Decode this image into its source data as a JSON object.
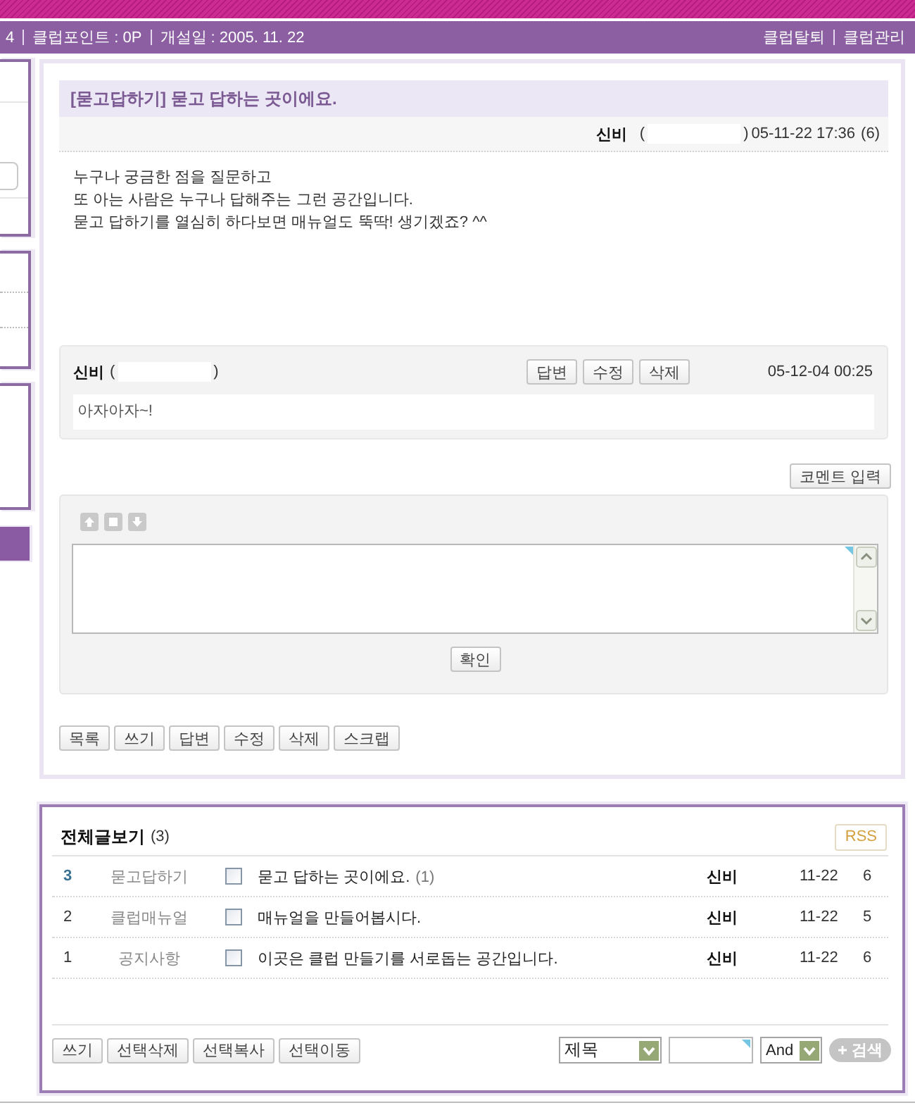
{
  "header": {
    "info": [
      "4",
      "클럽포인트 : 0P",
      "개설일 : 2005. 11. 22"
    ],
    "links": [
      "클럽탈퇴",
      "클럽관리"
    ]
  },
  "post": {
    "title": "[묻고답하기] 묻고 답하는 곳이에요.",
    "author": "신비",
    "id_brackets": [
      "(",
      ")"
    ],
    "datetime": "05-11-22 17:36",
    "views": "(6)",
    "body": [
      "누구나 궁금한 점을 질문하고",
      "또 아는 사람은 누구나 답해주는 그런 공간입니다.",
      "묻고 답하기를 열심히 하다보면 매뉴얼도 뚝딱! 생기겠죠? ^^"
    ]
  },
  "comments": [
    {
      "author": "신비",
      "id_brackets": [
        "(",
        ")"
      ],
      "buttons": [
        "답변",
        "수정",
        "삭제"
      ],
      "datetime": "05-12-04 00:25",
      "text": "아자아자~!"
    }
  ],
  "comment_form": {
    "open_button": "코멘트 입력",
    "submit_button": "확인"
  },
  "post_buttons": [
    "목록",
    "쓰기",
    "답변",
    "수정",
    "삭제",
    "스크랩"
  ],
  "board": {
    "title": "전체글보기",
    "count": "(3)",
    "rss": "RSS",
    "rows": [
      {
        "number": "3",
        "current": true,
        "category": "묻고답하기",
        "checked": false,
        "title": "묻고 답하는 곳이에요.",
        "comments": "(1)",
        "author": "신비",
        "date": "11-22",
        "views": "6"
      },
      {
        "number": "2",
        "current": false,
        "category": "클럽매뉴얼",
        "checked": false,
        "title": "매뉴얼을 만들어봅시다.",
        "author": "신비",
        "date": "11-22",
        "views": "5"
      },
      {
        "number": "1",
        "current": false,
        "category": "공지사항",
        "checked": false,
        "title": "이곳은 클럽 만들기를 서로돕는 공간입니다.",
        "author": "신비",
        "date": "11-22",
        "views": "6"
      }
    ],
    "buttons": [
      "쓰기",
      "선택삭제",
      "선택복사",
      "선택이동"
    ],
    "search": {
      "field": "제목",
      "operator": "And",
      "button": "검색"
    }
  }
}
